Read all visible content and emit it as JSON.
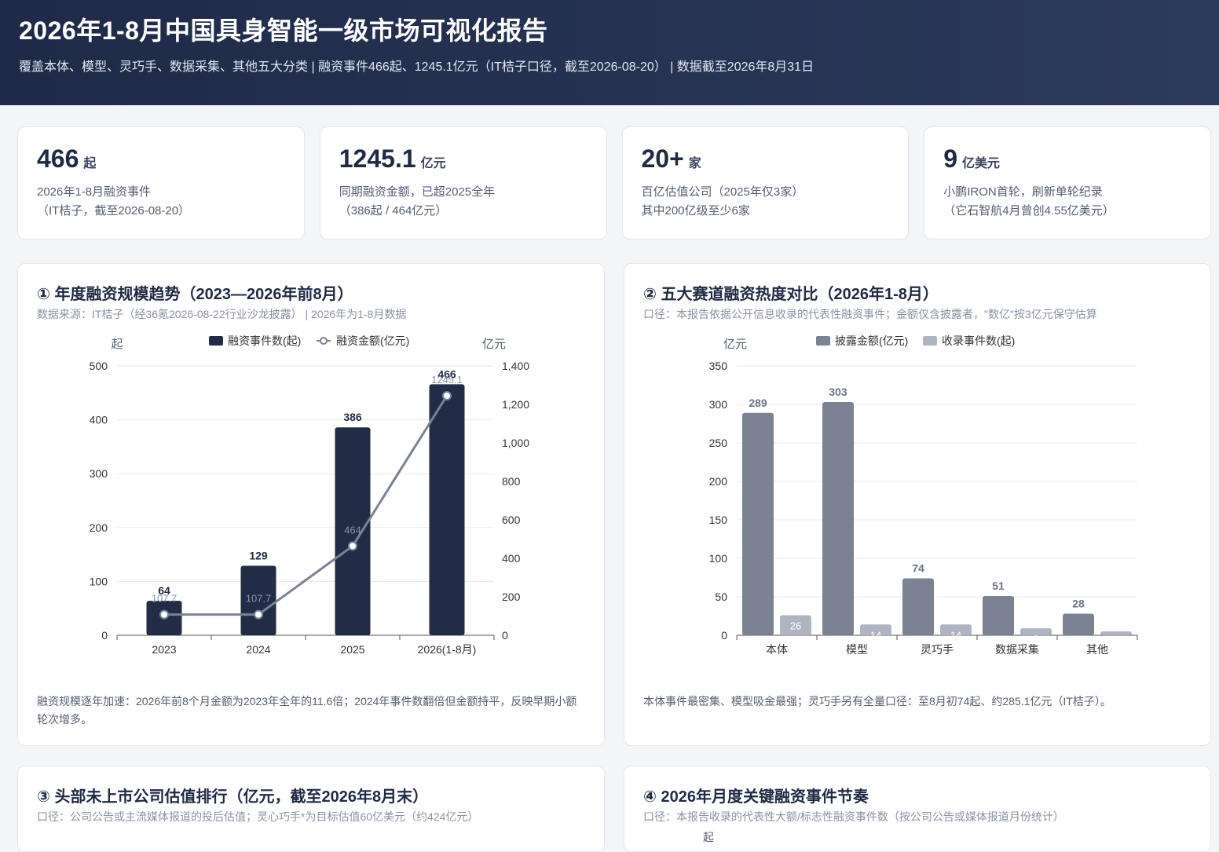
{
  "header": {
    "title": "2026年1-8月中国具身智能一级市场可视化报告",
    "subtitle": "覆盖本体、模型、灵巧手、数据采集、其他五大分类  |  融资事件466起、1245.1亿元（IT桔子口径，截至2026-08-20） |  数据截至2026年8月31日"
  },
  "stats": [
    {
      "num": "466",
      "unit": "起",
      "line1": "2026年1-8月融资事件",
      "line2": "（IT桔子，截至2026-08-20）"
    },
    {
      "num": "1245.1",
      "unit": "亿元",
      "line1": "同期融资金额，已超2025全年",
      "line2": "（386起 / 464亿元）"
    },
    {
      "num": "20+",
      "unit": "家",
      "line1": "百亿估值公司（2025年仅3家）",
      "line2": "其中200亿级至少6家"
    },
    {
      "num": "9",
      "unit": "亿美元",
      "line1": "小鹏IRON首轮，刷新单轮纪录",
      "line2": "（它石智航4月曾创4.55亿美元）"
    }
  ],
  "panels": {
    "p1": {
      "title": "① 年度融资规模趋势（2023—2026年前8月）",
      "note": "数据来源：IT桔子（经36氪2026-08-22行业沙龙披露） | 2026年为1-8月数据",
      "footer": "融资规模逐年加速：2026年前8个月金额为2023年全年的11.6倍；2024年事件数翻倍但金额持平，反映早期小额轮次增多。"
    },
    "p2": {
      "title": "② 五大赛道融资热度对比（2026年1-8月）",
      "note": "口径：本报告依据公开信息收录的代表性融资事件；金额仅含披露者，\"数亿\"按3亿元保守估算",
      "footer": "本体事件最密集、模型吸金最强；灵巧手另有全量口径：至8月初74起、约285.1亿元（IT桔子）。"
    },
    "p3": {
      "title": "③ 头部未上市公司估值排行（亿元，截至2026年8月末）",
      "note": "口径：公司公告或主流媒体报道的投后估值；灵心巧手*为目标估值60亿美元（约424亿元）"
    },
    "p4": {
      "title": "④ 2026年月度关键融资事件节奏",
      "note": "口径：本报告收录的代表性大额/标志性融资事件数（按公司公告或媒体报道月份统计）",
      "axis_label": "起"
    }
  },
  "chart_data": [
    {
      "type": "bar",
      "categories": [
        "2023",
        "2024",
        "2025",
        "2026(1-8月)"
      ],
      "series": [
        {
          "name": "融资事件数(起)",
          "type": "bar",
          "axis": "left",
          "values": [
            64,
            129,
            386,
            466
          ],
          "color": "#232c46"
        },
        {
          "name": "融资金额(亿元)",
          "type": "line",
          "axis": "right",
          "values": [
            107.7,
            107.7,
            464,
            1245.1
          ],
          "color": "#7a8294"
        }
      ],
      "ylabel": "起",
      "ylabel_right": "亿元",
      "ylim": [
        0,
        500
      ],
      "yticks": [
        0,
        100,
        200,
        300,
        400,
        500
      ],
      "ylim_right": [
        0,
        1400
      ],
      "yticks_right": [
        "0",
        "200",
        "400",
        "600",
        "800",
        "1,000",
        "1,200",
        "1,400"
      ],
      "legend": "top"
    },
    {
      "type": "bar",
      "categories": [
        "本体",
        "模型",
        "灵巧手",
        "数据采集",
        "其他"
      ],
      "series": [
        {
          "name": "披露金额(亿元)",
          "values": [
            289,
            303,
            74,
            51,
            28
          ],
          "color": "#7a8294"
        },
        {
          "name": "收录事件数(起)",
          "values": [
            26,
            14,
            14,
            9,
            5
          ],
          "color": "#aeb4c2"
        }
      ],
      "ylabel": "亿元",
      "ylim": [
        0,
        350
      ],
      "yticks": [
        0,
        50,
        100,
        150,
        200,
        250,
        300,
        350
      ],
      "legend": "top"
    }
  ]
}
